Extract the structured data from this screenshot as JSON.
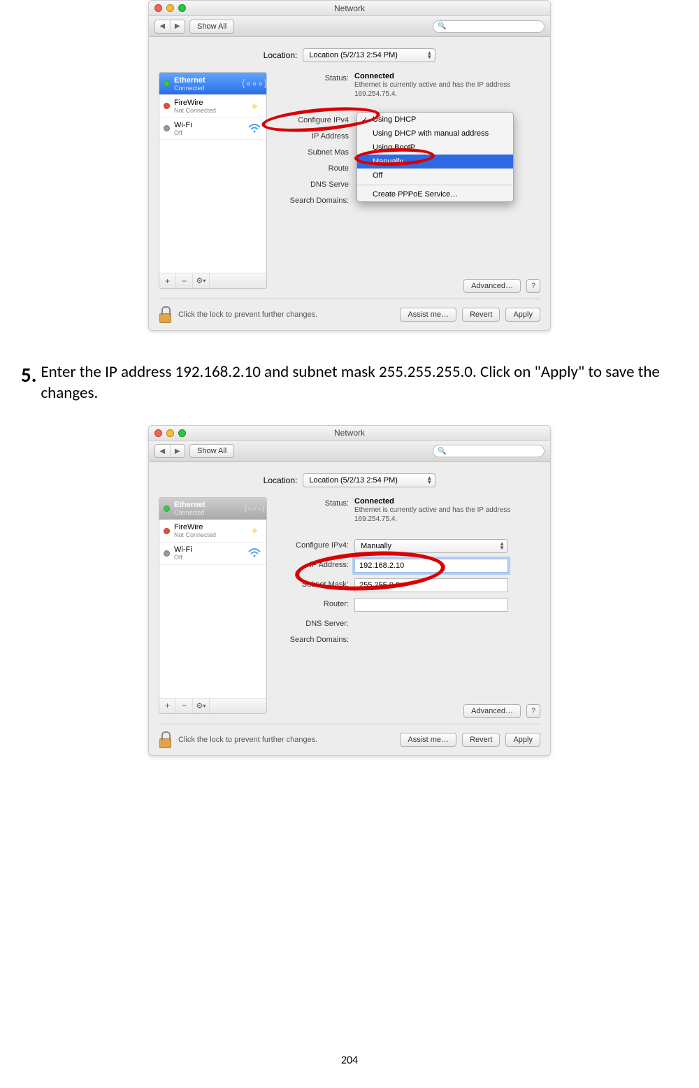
{
  "pagenum": "204",
  "instruction": {
    "num": "5.",
    "text": "Enter the IP address 192.168.2.10 and subnet mask 255.255.255.0. Click on \"Apply\" to save the changes."
  },
  "win1": {
    "title": "Network",
    "showall": "Show All",
    "location_label": "Location:",
    "location_value": "Location (5/2/13 2:54 PM)",
    "sidebar": {
      "ethernet": {
        "name": "Ethernet",
        "sub": "Connected"
      },
      "firewire": {
        "name": "FireWire",
        "sub": "Not Connected"
      },
      "wifi": {
        "name": "Wi-Fi",
        "sub": "Off"
      },
      "add": "+",
      "remove": "−",
      "gear": "⚙︎"
    },
    "fields": {
      "status_lbl": "Status:",
      "status_val": "Connected",
      "status_desc": "Ethernet is currently active and has the IP address 169.254.75.4.",
      "config_lbl": "Configure IPv4",
      "ip_lbl": "IP Address",
      "subnet_lbl": "Subnet Mas",
      "router_lbl": "Route",
      "dns_lbl": "DNS Serve",
      "search_lbl": "Search Domains:"
    },
    "menu": {
      "dhcp": "Using DHCP",
      "dhcp_manual": "Using DHCP with manual address",
      "bootp": "Using BootP",
      "manually": "Manually",
      "off": "Off",
      "pppoe": "Create PPPoE Service…"
    },
    "advanced": "Advanced…",
    "help": "?",
    "lock_text": "Click the lock to prevent further changes.",
    "assist": "Assist me…",
    "revert": "Revert",
    "apply": "Apply"
  },
  "win2": {
    "title": "Network",
    "showall": "Show All",
    "location_label": "Location:",
    "location_value": "Location (5/2/13 2:54 PM)",
    "sidebar": {
      "ethernet": {
        "name": "Ethernet",
        "sub": "Connected"
      },
      "firewire": {
        "name": "FireWire",
        "sub": "Not Connected"
      },
      "wifi": {
        "name": "Wi-Fi",
        "sub": "Off"
      },
      "add": "+",
      "remove": "−",
      "gear": "⚙︎"
    },
    "fields": {
      "status_lbl": "Status:",
      "status_val": "Connected",
      "status_desc": "Ethernet is currently active and has the IP address 169.254.75.4.",
      "config_lbl": "Configure IPv4:",
      "config_val": "Manually",
      "ip_lbl": "IP Address:",
      "ip_val": "192.168.2.10",
      "subnet_lbl": "Subnet Mask:",
      "subnet_val": "255.255.0.0",
      "router_lbl": "Router:",
      "dns_lbl": "DNS Server:",
      "search_lbl": "Search Domains:"
    },
    "advanced": "Advanced…",
    "help": "?",
    "lock_text": "Click the lock to prevent further changes.",
    "assist": "Assist me…",
    "revert": "Revert",
    "apply": "Apply"
  }
}
